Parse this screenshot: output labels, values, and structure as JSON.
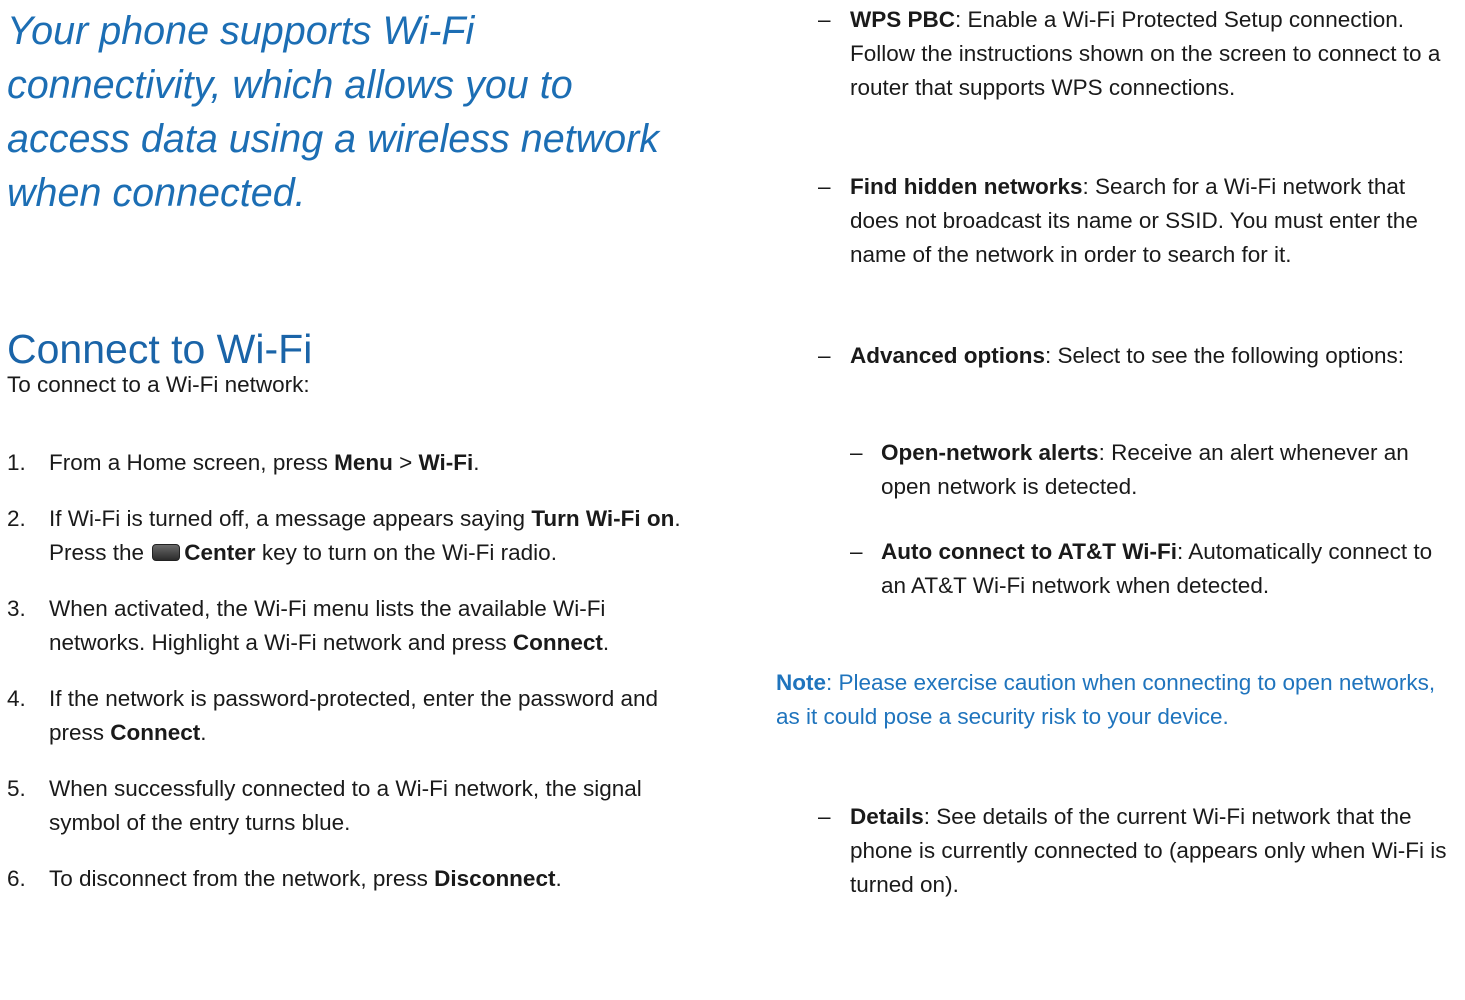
{
  "intro": "Your phone supports Wi-Fi connectivity, which allows you to access data using a wireless network when connected.",
  "heading": "Connect to Wi-Fi",
  "lead": "To connect to a Wi-Fi network:",
  "steps": [
    {
      "num": "1.",
      "t1": "From a Home screen, press ",
      "b1": "Menu",
      "t2": " > ",
      "b2": "Wi-Fi",
      "t3": "."
    },
    {
      "num": "2.",
      "t1": "If Wi-Fi is turned off, a message appears saying ",
      "b1": "Turn Wi-Fi on",
      "t2": ". Press the ",
      "icon": "center-key-icon",
      "b2": "Center",
      "t3": " key to turn on the Wi-Fi radio."
    },
    {
      "num": "3.",
      "t1": "When activated, the Wi-Fi menu lists the available Wi-Fi networks. Highlight a Wi-Fi network and press ",
      "b1": "Connect",
      "t2": "."
    },
    {
      "num": "4.",
      "t1": "If the network is password-protected, enter the password and press ",
      "b1": "Connect",
      "t2": "."
    },
    {
      "num": "5.",
      "t1": "When successfully connected to a Wi-Fi network, the signal symbol of the entry turns blue."
    },
    {
      "num": "6.",
      "t1": "To disconnect from the network, press ",
      "b1": "Disconnect",
      "t2": "."
    }
  ],
  "options": {
    "dash": "–",
    "wps": {
      "term": "WPS PBC",
      "desc": ": Enable a Wi-Fi Protected Setup connection. Follow the instructions shown on the screen to connect to a router that supports WPS connections."
    },
    "hidden": {
      "term": "Find hidden networks",
      "desc": ": Search for a Wi-Fi network that does not broadcast its name or SSID. You must enter the name of the network in order to search for it."
    },
    "advanced": {
      "term": "Advanced options",
      "desc": ": Select to see the following options:"
    },
    "open_alerts": {
      "term": "Open-network alerts",
      "desc": ": Receive an alert whenever an open network is detected."
    },
    "auto_connect": {
      "term": "Auto connect to AT&T Wi-Fi",
      "desc": ": Automatically connect to an AT&T Wi-Fi network when detected."
    },
    "details": {
      "term": "Details",
      "desc": ": See details of the current Wi-Fi network that the phone is currently connected to (appears only when Wi-Fi is turned on)."
    }
  },
  "note": {
    "label": "Note",
    "text": ": Please exercise caution when connecting to open networks, as it could pose a security risk to your device."
  },
  "colors": {
    "accent": "#1c6eb4",
    "heading": "#1a64a8",
    "note": "#1f74bd",
    "body": "#1a1a1a"
  }
}
